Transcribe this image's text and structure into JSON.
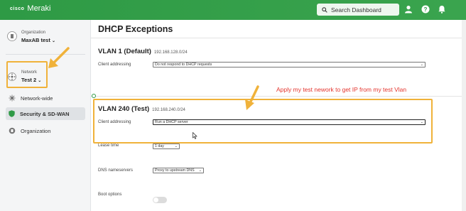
{
  "header": {
    "cisco_text": "cisco",
    "brand": "Meraki",
    "search_placeholder": "Search Dashboard",
    "icons": [
      "user-icon",
      "help-icon",
      "bell-icon"
    ]
  },
  "sidebar": {
    "organization": {
      "label": "Organization",
      "value": "MaxAB test"
    },
    "network": {
      "label": "Network",
      "value": "Test 2"
    },
    "items": [
      {
        "label": "Network-wide",
        "icon": "network-icon",
        "active": false
      },
      {
        "label": "Security & SD-WAN",
        "icon": "security-icon",
        "active": true
      },
      {
        "label": "Organization",
        "icon": "organization-icon",
        "active": false
      }
    ]
  },
  "main": {
    "title": "DHCP Exceptions",
    "vlan1": {
      "title": "VLAN 1 (Default)",
      "subnet": "192.168.128.0/24",
      "client_addressing_label": "Client addressing",
      "client_addressing_value": "Do not respond to DHCP requests"
    },
    "vlan240": {
      "title": "VLAN 240 (Test)",
      "subnet": "192.168.240.0/24",
      "client_addressing_label": "Client addressing",
      "client_addressing_value": "Run a DHCP server",
      "lease_time_label": "Lease time",
      "lease_time_value": "1 day",
      "dns_label": "DNS nameservers",
      "dns_value": "Proxy to upstream DNS",
      "boot_label": "Boot options"
    }
  },
  "annotation": {
    "text": "Apply my test nework to get IP from my test Vlan",
    "color": "#e4342d",
    "highlight_color": "#f0b23a"
  },
  "colors": {
    "topbar": "#2f9a47",
    "accent": "#2f9a47"
  }
}
